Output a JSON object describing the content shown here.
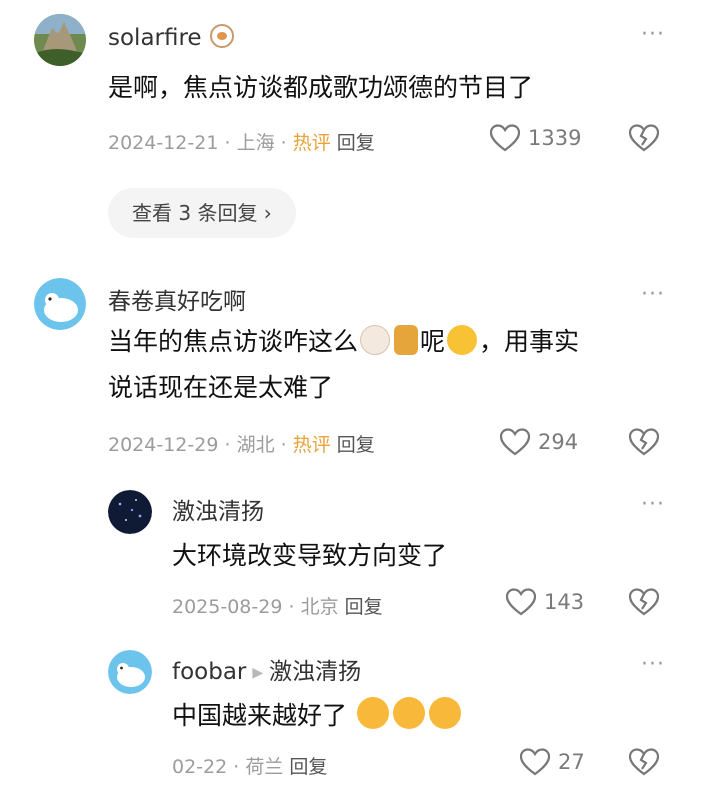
{
  "comments": [
    {
      "user": "solarfire",
      "text": "是啊，焦点访谈都成歌功颂德的节目了",
      "date": "2024-12-21",
      "location": "上海",
      "hot": "热评",
      "reply": "回复",
      "likes": "1339",
      "view_replies": "查看 3 条回复 ›"
    },
    {
      "user": "春卷真好吃啊",
      "text_a": "当年的焦点访谈咋这么",
      "text_b": "呢",
      "text_c": "，用事实",
      "text_line2": "说话现在还是太难了",
      "date": "2024-12-29",
      "location": "湖北",
      "hot": "热评",
      "reply": "回复",
      "likes": "294"
    }
  ],
  "replies": [
    {
      "user": "激浊清扬",
      "text": "大环境改变导致方向变了",
      "date": "2025-08-29",
      "location": "北京",
      "reply": "回复",
      "likes": "143"
    },
    {
      "user": "foobar",
      "reply_to": "激浊清扬",
      "text": "中国越来越好了",
      "date": "02-22",
      "location": "荷兰",
      "reply": "回复",
      "likes": "27"
    }
  ],
  "ui": {
    "more": "···",
    "sep": "·"
  },
  "icons": {
    "like": "heart-outline-icon",
    "dislike": "broken-heart-icon",
    "more": "more-dots-icon"
  }
}
